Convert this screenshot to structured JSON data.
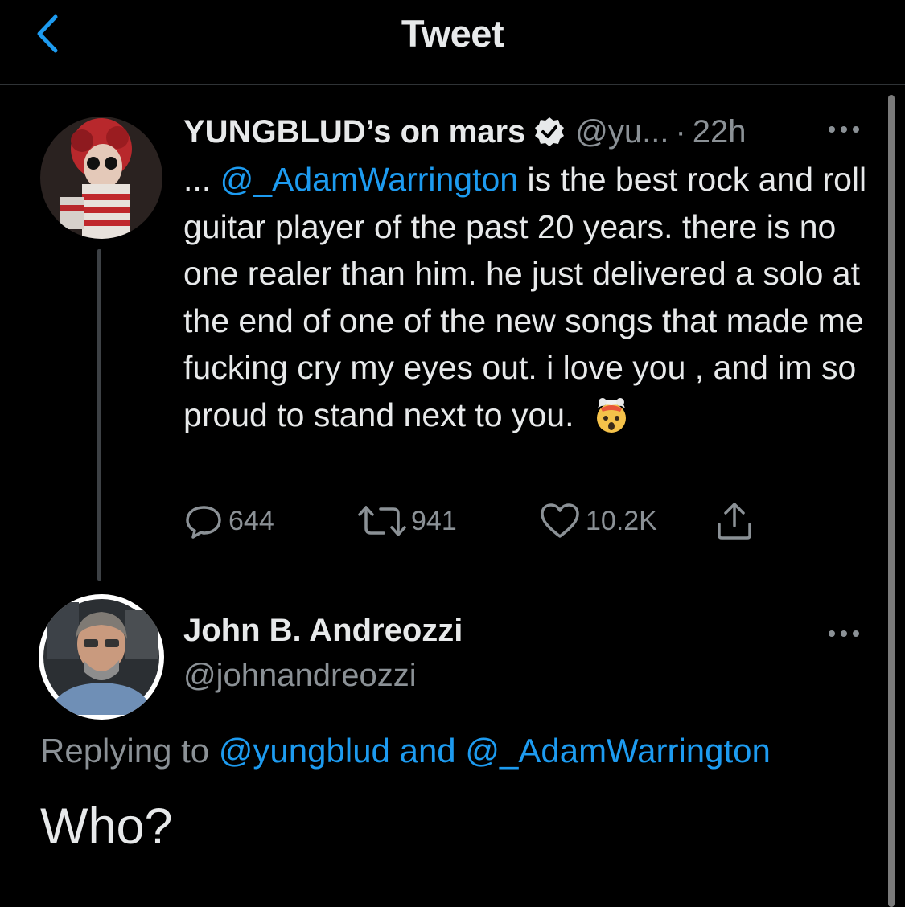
{
  "header": {
    "title": "Tweet"
  },
  "tweet": {
    "display_name": "YUNGBLUD’s on mars",
    "handle": "@yu...",
    "separator": "·",
    "time": "22h",
    "text_prefix": "... ",
    "mention": "@_AdamWarrington",
    "text_body": " is the best rock and roll guitar player of the past 20 years. there is no one realer than him. he just delivered a solo at the end of one of the new songs that made me fucking cry my eyes out. i love you , and im so proud to stand next to you. ",
    "emoji": "exploding-head-emoji",
    "replies": "644",
    "retweets": "941",
    "likes": "10.2K"
  },
  "reply": {
    "display_name": "John B. Andreozzi",
    "handle": "@johnandreozzi",
    "replying_prefix": "Replying to ",
    "replying_user1": "@yungblud",
    "replying_and": " and ",
    "replying_user2": "@_AdamWarrington",
    "text": "Who?"
  },
  "colors": {
    "background": "#000000",
    "accent": "#1d9bf0",
    "secondary_text": "#8b9196"
  }
}
